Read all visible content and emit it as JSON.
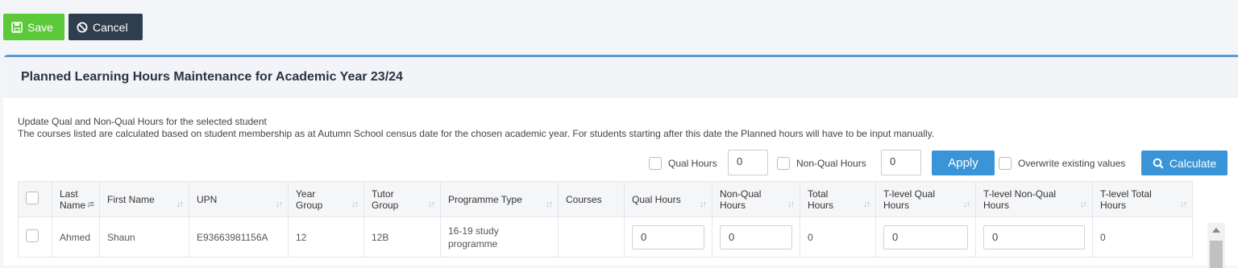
{
  "toolbar": {
    "save_label": "Save",
    "cancel_label": "Cancel"
  },
  "panel": {
    "title": "Planned Learning Hours Maintenance for Academic Year 23/24",
    "desc_line1": "Update Qual and Non-Qual Hours for the selected student",
    "desc_line2": "The courses listed are calculated based on student membership as at Autumn School census date for the chosen academic year. For students starting after this date the Planned hours will have to be input manually."
  },
  "controls": {
    "qual_label": "Qual Hours",
    "qual_value": "0",
    "nonqual_label": "Non-Qual Hours",
    "nonqual_value": "0",
    "apply_label": "Apply",
    "overwrite_label": "Overwrite existing values",
    "calculate_label": "Calculate"
  },
  "table": {
    "columns": [
      "Last Name",
      "First Name",
      "UPN",
      "Year Group",
      "Tutor Group",
      "Programme Type",
      "Courses",
      "Qual Hours",
      "Non-Qual Hours",
      "Total Hours",
      "T-level Qual Hours",
      "T-level Non-Qual Hours",
      "T-level Total Hours"
    ],
    "rows": [
      {
        "last_name": "Ahmed",
        "first_name": "Shaun",
        "upn": "E93663981156A",
        "year_group": "12",
        "tutor_group": "12B",
        "programme_type": "16-19 study programme",
        "courses": "",
        "qual_hours": "0",
        "nonqual_hours": "0",
        "total_hours": "0",
        "tlevel_qual": "0",
        "tlevel_nonqual": "0",
        "tlevel_total": "0"
      }
    ]
  }
}
